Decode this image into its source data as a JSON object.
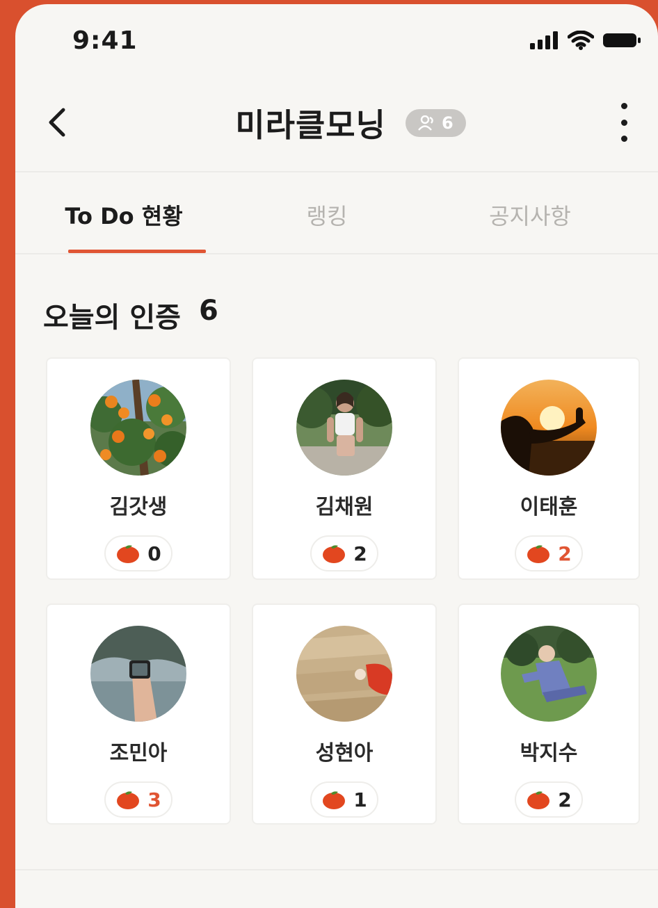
{
  "status_bar": {
    "time": "9:41"
  },
  "header": {
    "title": "미라클모닝",
    "member_count": "6"
  },
  "tabs": [
    {
      "label": "To Do 현황",
      "active": true
    },
    {
      "label": "랭킹",
      "active": false
    },
    {
      "label": "공지사항",
      "active": false
    }
  ],
  "section": {
    "title": "오늘의 인증",
    "count": "6"
  },
  "members": [
    {
      "name": "김갓생",
      "tomatoes": "0",
      "avatar": "orange-tree"
    },
    {
      "name": "김채원",
      "tomatoes": "2",
      "avatar": "runner"
    },
    {
      "name": "이태훈",
      "tomatoes": "2",
      "avatar": "sunset-yoga"
    },
    {
      "name": "조민아",
      "tomatoes": "3",
      "avatar": "lake-photo"
    },
    {
      "name": "성현아",
      "tomatoes": "1",
      "avatar": "grass-field"
    },
    {
      "name": "박지수",
      "tomatoes": "2",
      "avatar": "stretching"
    }
  ],
  "colors": {
    "accent": "#e05533",
    "background": "#f7f6f3",
    "frame": "#d9502e",
    "inactive_tab": "#b5b3af"
  }
}
